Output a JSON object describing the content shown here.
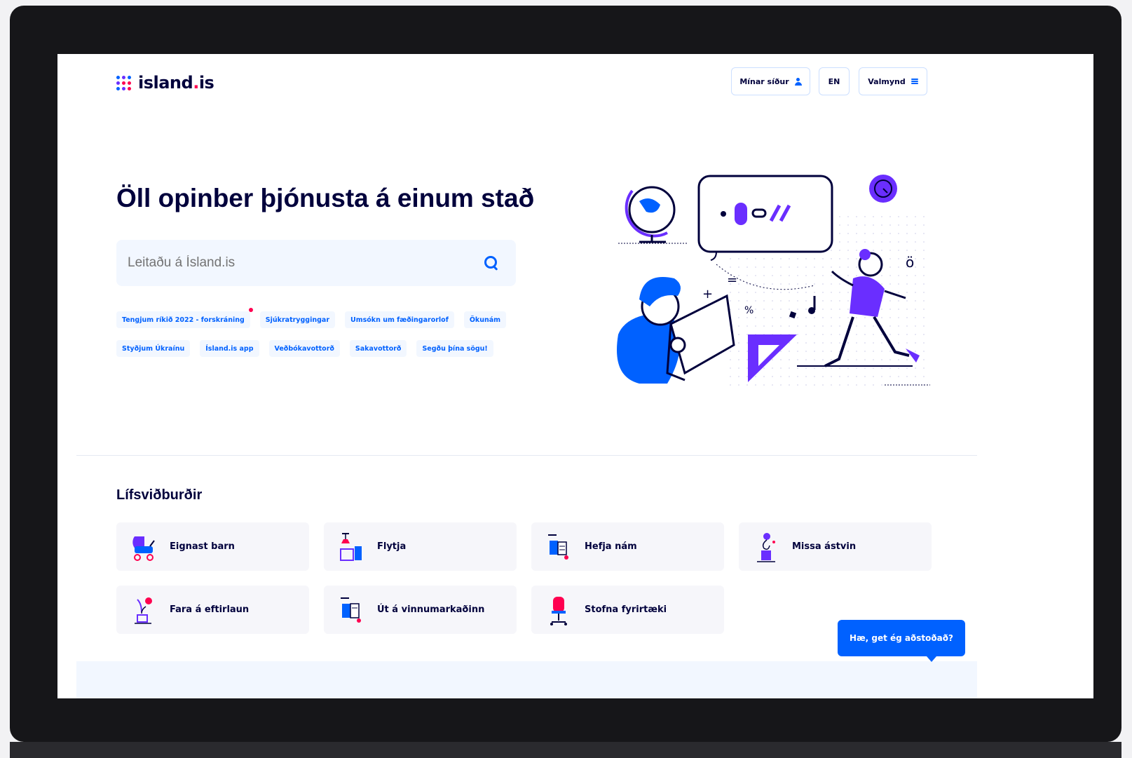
{
  "header": {
    "logo_text": "island",
    "logo_dot": ".",
    "logo_tld": "is",
    "logo_dot_colors": [
      "#0061ff",
      "#6a2eff",
      "#0061ff",
      "#6a2eff",
      "#ff0050",
      "#ff0050",
      "#0061ff",
      "#6a2eff",
      "#ff0050"
    ],
    "my_pages_label": "Mínar síður",
    "lang_label": "EN",
    "menu_label": "Valmynd"
  },
  "hero": {
    "title": "Öll opinber þjónusta á einum stað",
    "search_placeholder": "Leitaðu á Ísland.is",
    "tags": [
      {
        "label": "Tengjum ríkið 2022 - forskráning",
        "new": true
      },
      {
        "label": "Sjúkratryggingar",
        "new": false
      },
      {
        "label": "Umsókn um fæðingarorlof",
        "new": false
      },
      {
        "label": "Ökunám",
        "new": false
      },
      {
        "label": "Styðjum Úkraínu",
        "new": false
      },
      {
        "label": "Ísland.is app",
        "new": false
      },
      {
        "label": "Veðbókavottorð",
        "new": false
      },
      {
        "label": "Sakavottorð",
        "new": false
      },
      {
        "label": "Segðu þína sögu!",
        "new": false
      }
    ]
  },
  "life_events": {
    "title": "Lífsviðburðir",
    "items": [
      {
        "label": "Eignast barn",
        "icon": "baby-stroller-icon"
      },
      {
        "label": "Flytja",
        "icon": "moving-lamp-icon"
      },
      {
        "label": "Hefja nám",
        "icon": "books-icon"
      },
      {
        "label": "Missa ástvin",
        "icon": "lamp-flower-icon"
      },
      {
        "label": "Fara á eftirlaun",
        "icon": "retirement-plant-icon"
      },
      {
        "label": "Út á vinnumarkaðinn",
        "icon": "work-desk-icon"
      },
      {
        "label": "Stofna fyrirtæki",
        "icon": "office-chair-icon"
      }
    ]
  },
  "chat": {
    "label": "Hæ, get ég aðstoðað?"
  },
  "colors": {
    "brand_blue": "#0061ff",
    "brand_navy": "#00003c",
    "brand_purple": "#6a2eff",
    "brand_red": "#ff0050"
  }
}
